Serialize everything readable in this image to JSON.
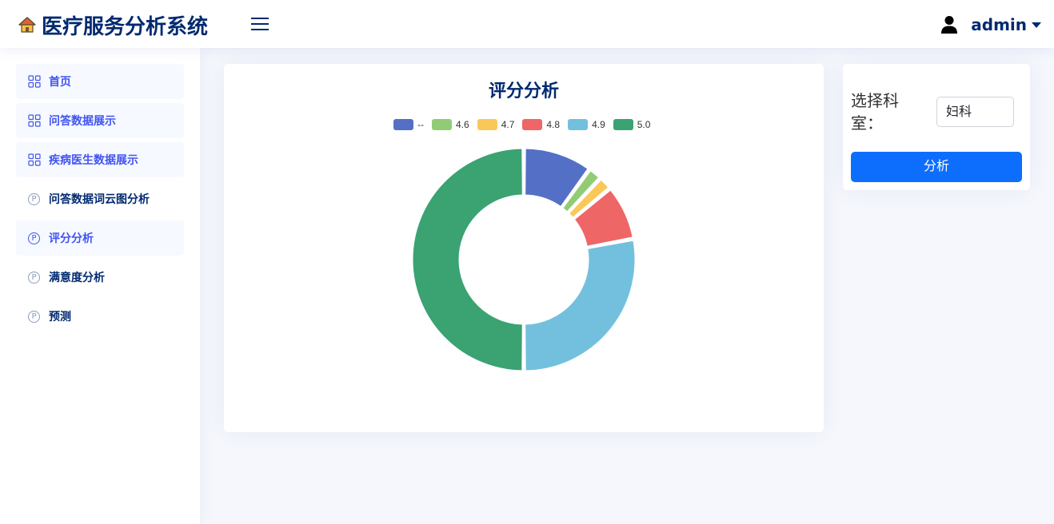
{
  "header": {
    "app_title": "医疗服务分析系统",
    "logo_icon": "house-icon",
    "menu_icon": "hamburger-icon",
    "user": {
      "name": "admin",
      "icon": "user-icon"
    }
  },
  "sidebar": {
    "items": [
      {
        "label": "首页",
        "icon": "grid-icon",
        "active": true
      },
      {
        "label": "问答数据展示",
        "icon": "grid-icon",
        "active": true
      },
      {
        "label": "疾病医生数据展示",
        "icon": "grid-icon",
        "active": true
      },
      {
        "label": "问答数据词云图分析",
        "icon": "p-circle-icon",
        "active": false
      },
      {
        "label": "评分分析",
        "icon": "p-circle-icon",
        "active": true
      },
      {
        "label": "满意度分析",
        "icon": "p-circle-icon",
        "active": false
      },
      {
        "label": "预测",
        "icon": "p-circle-icon",
        "active": false
      }
    ]
  },
  "main": {
    "form": {
      "label": "选择科室：",
      "selected_department": "妇科",
      "button_label": "分析"
    }
  },
  "chart_data": {
    "type": "pie",
    "variant": "donut",
    "title": "评分分析",
    "legend_position": "top-center",
    "series": [
      {
        "name": "--",
        "value": 10,
        "color": "#5470c6"
      },
      {
        "name": "4.6",
        "value": 2,
        "color": "#91cc75"
      },
      {
        "name": "4.7",
        "value": 2,
        "color": "#fac858"
      },
      {
        "name": "4.8",
        "value": 8,
        "color": "#ee6666"
      },
      {
        "name": "4.9",
        "value": 28,
        "color": "#73c0de"
      },
      {
        "name": "5.0",
        "value": 50,
        "color": "#3ba272"
      }
    ]
  }
}
